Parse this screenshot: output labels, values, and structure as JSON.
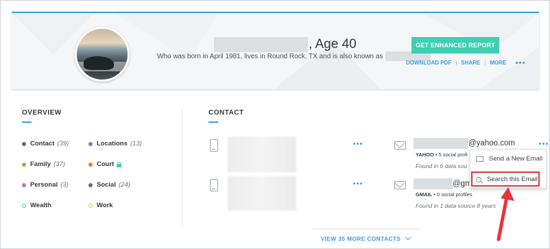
{
  "header": {
    "age_label": ", Age 40",
    "subtitle": "Who was born in April 1981, lives in Round Rock, TX and is also known as",
    "report_button": "GET ENHANCED REPORT",
    "actions": {
      "download": "DOWNLOAD PDF",
      "share": "SHARE",
      "more": "MORE",
      "separator": "|"
    }
  },
  "overview": {
    "title": "OVERVIEW",
    "items": [
      {
        "label": "Contact",
        "count": "(39)",
        "color": "#5a6a7a"
      },
      {
        "label": "Locations",
        "count": "(13)",
        "color": "#6b7fd4"
      },
      {
        "label": "Family",
        "count": "(37)",
        "color": "#7cc142"
      },
      {
        "label": "Court",
        "count": "",
        "color": "#f07a1a"
      },
      {
        "label": "Personal",
        "count": "(3)",
        "color": "#b07ad0"
      },
      {
        "label": "Social",
        "count": "(24)",
        "color": "#4f6e9c"
      },
      {
        "label": "Wealth",
        "count": "",
        "color": "#3fcfb3"
      },
      {
        "label": "Work",
        "count": "",
        "color": "#f2b81a"
      }
    ]
  },
  "contact": {
    "title": "CONTACT",
    "emails": [
      {
        "domain": "@yahoo.com",
        "provider": "YAHOO",
        "profiles": " • 5 social profi",
        "found": "Found in 6 data sou"
      },
      {
        "domain": "@gm",
        "provider": "GMAIL",
        "profiles": " • 0 social profiles",
        "found": "Found in 1 data source 8 years"
      }
    ],
    "menu": {
      "send": "Send a New Email",
      "search": "Search this Email"
    },
    "more_link": "VIEW 35 MORE CONTACTS"
  },
  "colors": {
    "accent": "#3aa0e0",
    "button": "#3fcfb3",
    "highlight": "#e8333a"
  }
}
